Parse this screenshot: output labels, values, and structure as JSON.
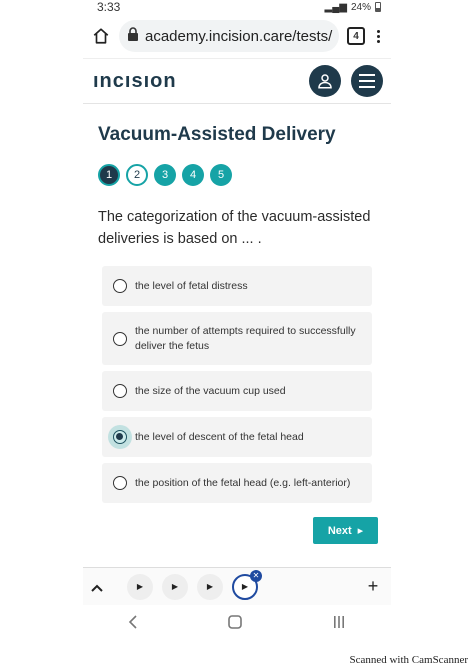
{
  "status": {
    "time": "3:33",
    "battery": "24%"
  },
  "browser": {
    "url": "academy.incision.care/tests/",
    "tab_count": "4"
  },
  "app": {
    "logo": "ıncısıon"
  },
  "page": {
    "title": "Vacuum-Assisted Delivery",
    "steps": [
      "1",
      "2",
      "3",
      "4",
      "5"
    ],
    "question": "The categorization of the vacuum-assisted deliveries is based on ... .",
    "options": [
      "the level of fetal distress",
      "the number of attempts required to successfully deliver the fetus",
      "the size of the vacuum cup used",
      "the level of descent of the fetal head",
      "the position of the fetal head (e.g. left-anterior)"
    ],
    "selected_option": 3,
    "next_label": "Next"
  },
  "watermark": "Scanned with CamScanner",
  "colors": {
    "teal": "#16a3a6",
    "navy": "#1f3a4b"
  }
}
